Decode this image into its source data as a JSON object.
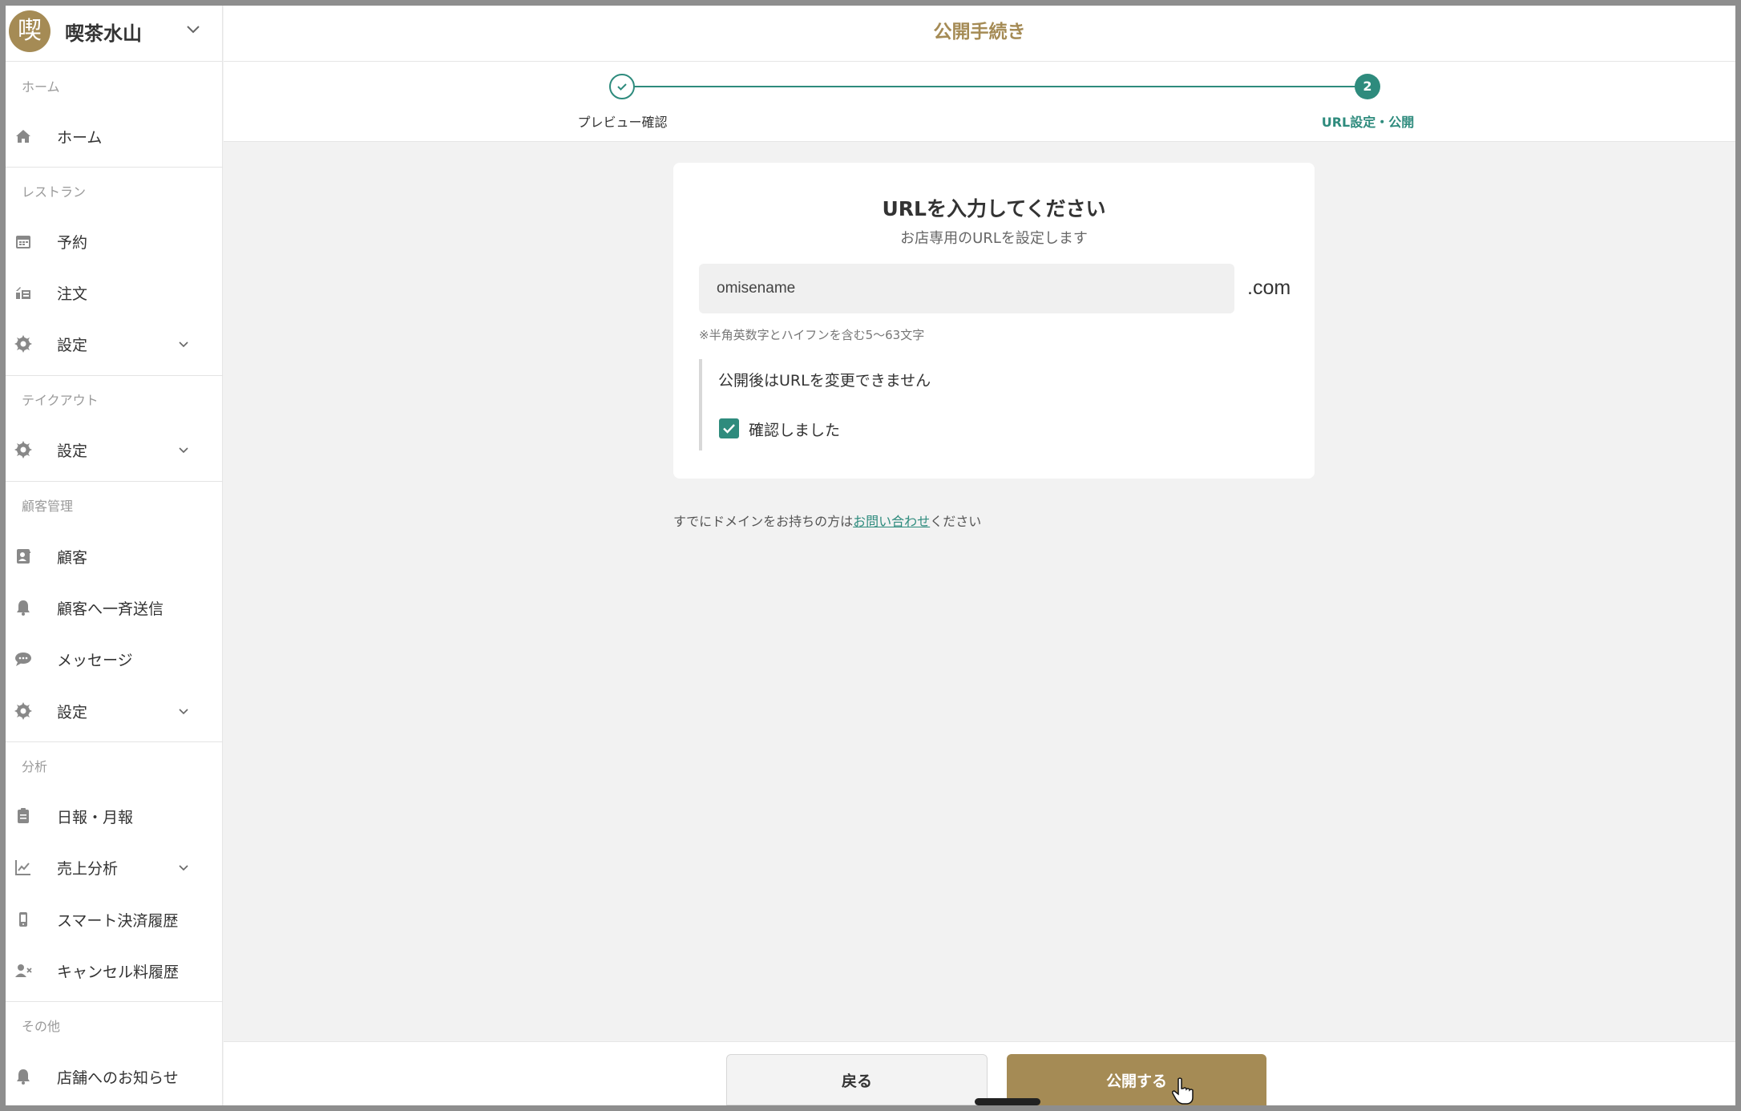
{
  "brand": {
    "logo_char": "喫",
    "name": "喫茶水山"
  },
  "sidebar": {
    "sections": [
      {
        "label": "ホーム"
      },
      {
        "label": "レストラン"
      },
      {
        "label": "テイクアウト"
      },
      {
        "label": "顧客管理"
      },
      {
        "label": "分析"
      },
      {
        "label": "その他"
      }
    ],
    "items": [
      {
        "label": "ホーム",
        "icon": "home-icon"
      },
      {
        "label": "予約",
        "icon": "calendar-icon"
      },
      {
        "label": "注文",
        "icon": "order-icon"
      },
      {
        "label": "設定",
        "icon": "gear-icon"
      },
      {
        "label": "設定",
        "icon": "gear-icon"
      },
      {
        "label": "顧客",
        "icon": "contact-book-icon"
      },
      {
        "label": "顧客へ一斉送信",
        "icon": "bell-icon"
      },
      {
        "label": "メッセージ",
        "icon": "chat-icon"
      },
      {
        "label": "設定",
        "icon": "gear-icon"
      },
      {
        "label": "日報・月報",
        "icon": "clipboard-icon"
      },
      {
        "label": "売上分析",
        "icon": "chart-line-icon"
      },
      {
        "label": "スマート決済履歴",
        "icon": "phone-icon"
      },
      {
        "label": "キャンセル料履歴",
        "icon": "user-x-icon"
      },
      {
        "label": "店舗へのお知らせ",
        "icon": "bell-icon"
      }
    ]
  },
  "header": {
    "title": "公開手続き"
  },
  "stepper": {
    "steps": [
      {
        "label": "プレビュー確認",
        "state": "done"
      },
      {
        "label": "URL設定・公開",
        "number": "2",
        "state": "current"
      }
    ]
  },
  "card": {
    "title": "URLを入力してください",
    "subtitle": "お店専用のURLを設定します",
    "url_value": "omisename",
    "url_suffix": ".com",
    "url_note": "※半角英数字とハイフンを含む5〜63文字",
    "warning": "公開後はURLを変更できません",
    "confirm_label": "確認しました",
    "confirm_checked": true
  },
  "domain_note": {
    "before": "すでにドメインをお持ちの方は",
    "link": "お問い合わせ",
    "after": "ください"
  },
  "footer": {
    "back_label": "戻る",
    "publish_label": "公開する"
  },
  "colors": {
    "brand": "#a58b55",
    "accent": "#2e8b7d"
  }
}
